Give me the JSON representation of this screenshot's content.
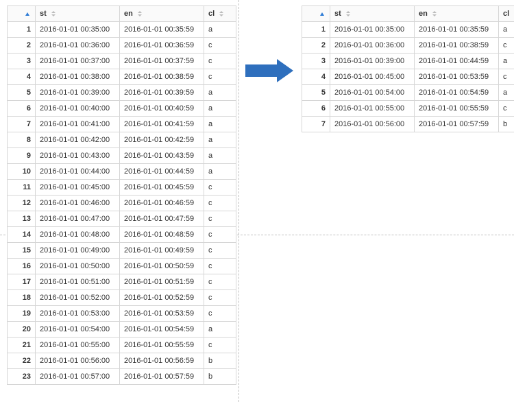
{
  "headers": {
    "idx": "",
    "st": "st",
    "en": "en",
    "cl": "cl"
  },
  "left_table": [
    {
      "idx": "1",
      "st": "2016-01-01 00:35:00",
      "en": "2016-01-01 00:35:59",
      "cl": "a"
    },
    {
      "idx": "2",
      "st": "2016-01-01 00:36:00",
      "en": "2016-01-01 00:36:59",
      "cl": "c"
    },
    {
      "idx": "3",
      "st": "2016-01-01 00:37:00",
      "en": "2016-01-01 00:37:59",
      "cl": "c"
    },
    {
      "idx": "4",
      "st": "2016-01-01 00:38:00",
      "en": "2016-01-01 00:38:59",
      "cl": "c"
    },
    {
      "idx": "5",
      "st": "2016-01-01 00:39:00",
      "en": "2016-01-01 00:39:59",
      "cl": "a"
    },
    {
      "idx": "6",
      "st": "2016-01-01 00:40:00",
      "en": "2016-01-01 00:40:59",
      "cl": "a"
    },
    {
      "idx": "7",
      "st": "2016-01-01 00:41:00",
      "en": "2016-01-01 00:41:59",
      "cl": "a"
    },
    {
      "idx": "8",
      "st": "2016-01-01 00:42:00",
      "en": "2016-01-01 00:42:59",
      "cl": "a"
    },
    {
      "idx": "9",
      "st": "2016-01-01 00:43:00",
      "en": "2016-01-01 00:43:59",
      "cl": "a"
    },
    {
      "idx": "10",
      "st": "2016-01-01 00:44:00",
      "en": "2016-01-01 00:44:59",
      "cl": "a"
    },
    {
      "idx": "11",
      "st": "2016-01-01 00:45:00",
      "en": "2016-01-01 00:45:59",
      "cl": "c"
    },
    {
      "idx": "12",
      "st": "2016-01-01 00:46:00",
      "en": "2016-01-01 00:46:59",
      "cl": "c"
    },
    {
      "idx": "13",
      "st": "2016-01-01 00:47:00",
      "en": "2016-01-01 00:47:59",
      "cl": "c"
    },
    {
      "idx": "14",
      "st": "2016-01-01 00:48:00",
      "en": "2016-01-01 00:48:59",
      "cl": "c"
    },
    {
      "idx": "15",
      "st": "2016-01-01 00:49:00",
      "en": "2016-01-01 00:49:59",
      "cl": "c"
    },
    {
      "idx": "16",
      "st": "2016-01-01 00:50:00",
      "en": "2016-01-01 00:50:59",
      "cl": "c"
    },
    {
      "idx": "17",
      "st": "2016-01-01 00:51:00",
      "en": "2016-01-01 00:51:59",
      "cl": "c"
    },
    {
      "idx": "18",
      "st": "2016-01-01 00:52:00",
      "en": "2016-01-01 00:52:59",
      "cl": "c"
    },
    {
      "idx": "19",
      "st": "2016-01-01 00:53:00",
      "en": "2016-01-01 00:53:59",
      "cl": "c"
    },
    {
      "idx": "20",
      "st": "2016-01-01 00:54:00",
      "en": "2016-01-01 00:54:59",
      "cl": "a"
    },
    {
      "idx": "21",
      "st": "2016-01-01 00:55:00",
      "en": "2016-01-01 00:55:59",
      "cl": "c"
    },
    {
      "idx": "22",
      "st": "2016-01-01 00:56:00",
      "en": "2016-01-01 00:56:59",
      "cl": "b"
    },
    {
      "idx": "23",
      "st": "2016-01-01 00:57:00",
      "en": "2016-01-01 00:57:59",
      "cl": "b"
    }
  ],
  "right_table": [
    {
      "idx": "1",
      "st": "2016-01-01 00:35:00",
      "en": "2016-01-01 00:35:59",
      "cl": "a"
    },
    {
      "idx": "2",
      "st": "2016-01-01 00:36:00",
      "en": "2016-01-01 00:38:59",
      "cl": "c"
    },
    {
      "idx": "3",
      "st": "2016-01-01 00:39:00",
      "en": "2016-01-01 00:44:59",
      "cl": "a"
    },
    {
      "idx": "4",
      "st": "2016-01-01 00:45:00",
      "en": "2016-01-01 00:53:59",
      "cl": "c"
    },
    {
      "idx": "5",
      "st": "2016-01-01 00:54:00",
      "en": "2016-01-01 00:54:59",
      "cl": "a"
    },
    {
      "idx": "6",
      "st": "2016-01-01 00:55:00",
      "en": "2016-01-01 00:55:59",
      "cl": "c"
    },
    {
      "idx": "7",
      "st": "2016-01-01 00:56:00",
      "en": "2016-01-01 00:57:59",
      "cl": "b"
    }
  ]
}
